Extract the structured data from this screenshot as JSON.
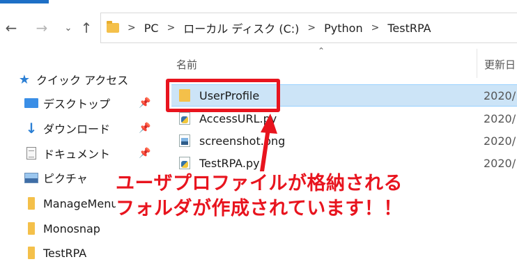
{
  "addressbar": {
    "crumbs": [
      "PC",
      "ローカル ディスク (C:)",
      "Python",
      "TestRPA"
    ],
    "separator": ">"
  },
  "columns": {
    "name": "名前",
    "date": "更新日"
  },
  "sidebar": {
    "quick_access": "クイック アクセス",
    "items": [
      {
        "label": "デスクトップ",
        "icon": "desktop-icon",
        "pinned": true
      },
      {
        "label": "ダウンロード",
        "icon": "download-icon",
        "pinned": true
      },
      {
        "label": "ドキュメント",
        "icon": "document-icon",
        "pinned": true
      },
      {
        "label": "ピクチャ",
        "icon": "pictures-icon",
        "pinned": true
      },
      {
        "label": "ManageMenuI...",
        "icon": "folder-icon",
        "pinned": false
      },
      {
        "label": "Monosnap",
        "icon": "folder-icon",
        "pinned": false
      },
      {
        "label": "TestRPA",
        "icon": "folder-icon",
        "pinned": false
      }
    ]
  },
  "files": [
    {
      "name": "UserProfile",
      "date": "2020/",
      "type": "folder",
      "selected": true
    },
    {
      "name": "AccessURL.py",
      "date": "2020/",
      "type": "python"
    },
    {
      "name": "screenshot.png",
      "date": "2020/",
      "type": "image"
    },
    {
      "name": "TestRPA.py",
      "date": "2020/",
      "type": "python"
    }
  ],
  "annotation": {
    "line1": "ユーザプロファイルが格納される",
    "line2": "フォルダが作成されています！！",
    "color": "#e8141e"
  }
}
